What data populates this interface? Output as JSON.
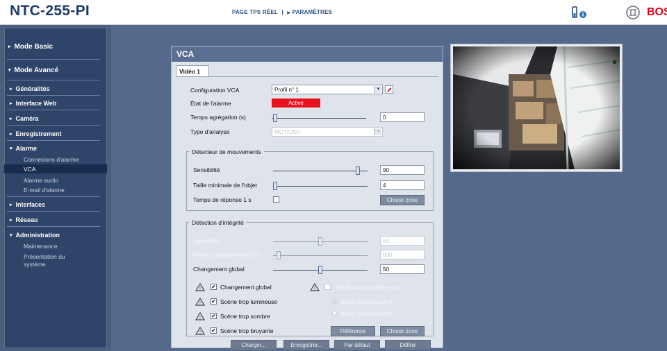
{
  "header": {
    "title": "NTC-255-PI",
    "nav_live": "PAGE TPS RÉEL",
    "nav_sep": "|",
    "nav_settings": "PARAMÈTRES",
    "brand": "BOSCH"
  },
  "sidebar": {
    "mode_basic": "Mode Basic",
    "mode_advanced": "Mode Avancé",
    "sections": {
      "general": "Généralités",
      "web": "Interface Web",
      "camera": "Caméra",
      "recording": "Enregistrement",
      "alarm": "Alarme",
      "interfaces": "Interfaces",
      "network": "Réseau",
      "admin": "Administration"
    },
    "alarm_items": [
      "Connexions d'alarme",
      "VCA",
      "Alarme audio",
      "E-mail d'alarme"
    ],
    "admin_items": [
      "Maintenance",
      "Présentation du",
      "système"
    ]
  },
  "vca": {
    "title": "VCA",
    "tab": "Vidéo 1",
    "config_label": "Configuration VCA",
    "config_value": "Profil n° 1",
    "alarm_state_label": "État de l'alarme",
    "alarm_state_value": "Active",
    "aggregation_label": "Temps agrégation (s)",
    "aggregation_value": "0",
    "analysis_label": "Type d'analyse",
    "analysis_value": "MOTION+",
    "motion": {
      "title": "Détecteur de mouvements",
      "sensitivity_label": "Sensibilité",
      "sensitivity_value": "90",
      "sensitivity_level": 0.9,
      "min_size_label": "Taille minimale de l'objet",
      "min_size_value": "4",
      "response_label": "Temps de réponse 1 s",
      "zone_button": "Choisir zone"
    },
    "integrity": {
      "title": "Détection d'intégrité",
      "sensitivity_label": "Sensibilité",
      "sensitivity_value": "50",
      "delay_label": "Retard déclenchement (s)",
      "delay_value": "600",
      "global_change_label": "Changement global",
      "global_change_value": "50",
      "checks": [
        "Changement global",
        "Scène trop lumineuse",
        "Scène trop sombre",
        "Scène trop bruyante"
      ],
      "reference_check": "Vérification de référence",
      "edges_disappear": "Bords disparaissent",
      "edges_appear": "Bords apparaissent",
      "reference_button": "Référence",
      "zone_button": "Choisir zone"
    },
    "buttons": {
      "load": "Charger...",
      "save": "Enregistrer...",
      "default": "Par défaut",
      "define": "Définir"
    }
  },
  "colors": {
    "alarm_active": "#e7141f",
    "brand_red": "#e2001a",
    "title_blue": "#1c3a6b"
  }
}
